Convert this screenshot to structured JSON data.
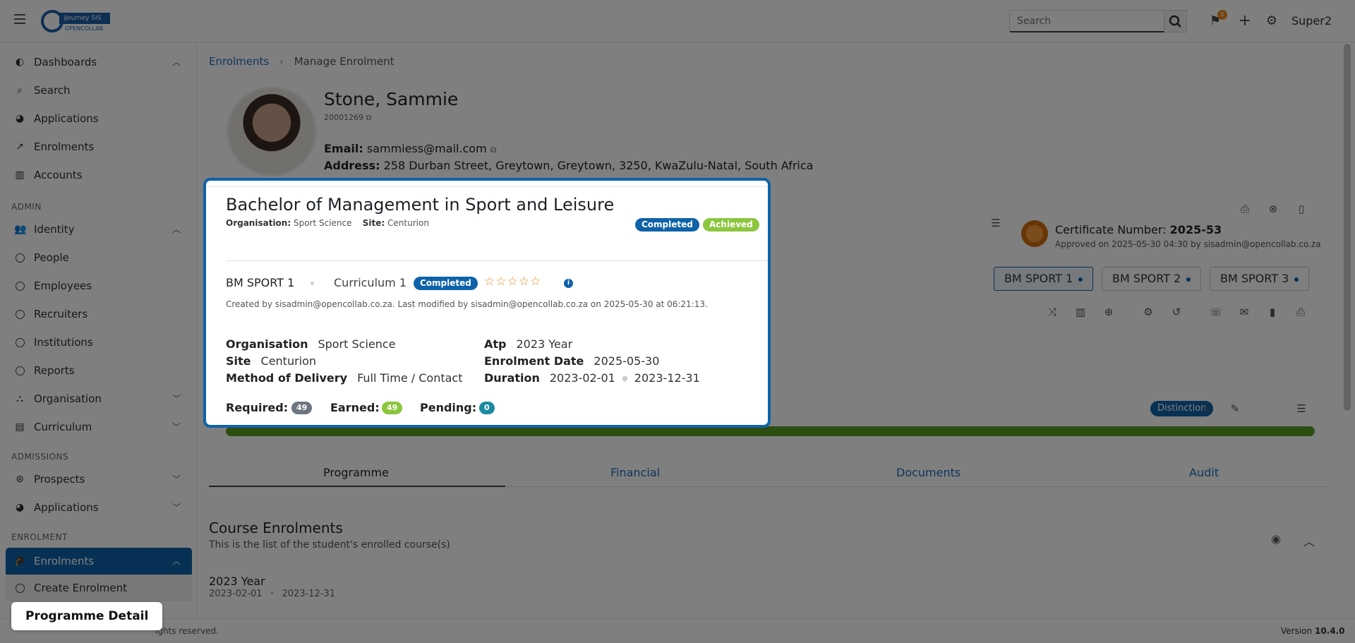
{
  "topbar": {
    "logo_text": "iJourney SIS",
    "logo_sub": "OPENCOLLAB",
    "search_placeholder": "Search",
    "notif_count": "0",
    "user": "Super2"
  },
  "sidebar": {
    "items_top": [
      {
        "label": "Dashboards",
        "icon": "palette-icon"
      },
      {
        "label": "Search",
        "icon": "search-icon"
      },
      {
        "label": "Applications",
        "icon": "pie-chart-icon"
      },
      {
        "label": "Enrolments",
        "icon": "line-chart-icon"
      },
      {
        "label": "Accounts",
        "icon": "bank-icon"
      }
    ],
    "section_admin": "ADMIN",
    "identity": "Identity",
    "identity_items": [
      "People",
      "Employees",
      "Recruiters",
      "Institutions",
      "Reports"
    ],
    "organisation": "Organisation",
    "curriculum": "Curriculum",
    "section_admissions": "ADMISSIONS",
    "prospects": "Prospects",
    "applications": "Applications",
    "section_enrolment": "ENROLMENT",
    "enrolments": "Enrolments",
    "create_enrolment": "Create Enrolment"
  },
  "breadcrumb": {
    "link": "Enrolments",
    "sep": "›",
    "current": "Manage Enrolment"
  },
  "profile": {
    "name": "Stone, Sammie",
    "id": "20001269",
    "email_label": "Email:",
    "email": "sammiess@mail.com",
    "address_label": "Address:",
    "address": "258 Durban Street, Greytown, Greytown, 3250, KwaZulu-Natal, South Africa"
  },
  "certificate": {
    "label": "Certificate Number:",
    "number": "2025-53",
    "approved": "Approved on 2025-05-30 04:30 by sisadmin@opencollab.co.za"
  },
  "programme_tabs": [
    "BM SPORT 1",
    "BM SPORT 2",
    "BM SPORT 3"
  ],
  "distinction": "Distinction",
  "progress": 1.0,
  "tabs": [
    "Programme",
    "Financial",
    "Documents",
    "Audit"
  ],
  "course_section": {
    "title": "Course Enrolments",
    "subtitle": "This is the list of the student's enrolled course(s)",
    "year": "2023 Year",
    "start": "2023-02-01",
    "end": "2023-12-31"
  },
  "card": {
    "title": "Bachelor of Management in Sport and Leisure",
    "org_label": "Organisation:",
    "org": "Sport Science",
    "site_label": "Site:",
    "site": "Centurion",
    "status": "Completed",
    "result": "Achieved",
    "code": "BM SPORT 1",
    "curriculum": "Curriculum 1",
    "curriculum_status": "Completed",
    "rating": 0,
    "created": "Created by sisadmin@opencollab.co.za. Last modified by sisadmin@opencollab.co.za on 2025-05-30 at 06:21:13.",
    "f_org_label": "Organisation",
    "f_org": "Sport Science",
    "f_site_label": "Site",
    "f_site": "Centurion",
    "f_mod_label": "Method of Delivery",
    "f_mod": "Full Time / Contact",
    "f_atp_label": "Atp",
    "f_atp": "2023 Year",
    "f_enrol_label": "Enrolment Date",
    "f_enrol": "2025-05-30",
    "f_dur_label": "Duration",
    "f_dur_start": "2023-02-01",
    "f_dur_end": "2023-12-31",
    "required_label": "Required:",
    "required": "49",
    "earned_label": "Earned:",
    "earned": "49",
    "pending_label": "Pending:",
    "pending": "0"
  },
  "footer": {
    "copy": "ights reserved.",
    "version_label": "Version",
    "version": "10.4.0"
  },
  "tooltip": "Programme Detail",
  "colors": {
    "primary": "#0e62a9",
    "achieved": "#8cc63f",
    "progress": "#5c9b24",
    "star": "#e8871e"
  }
}
